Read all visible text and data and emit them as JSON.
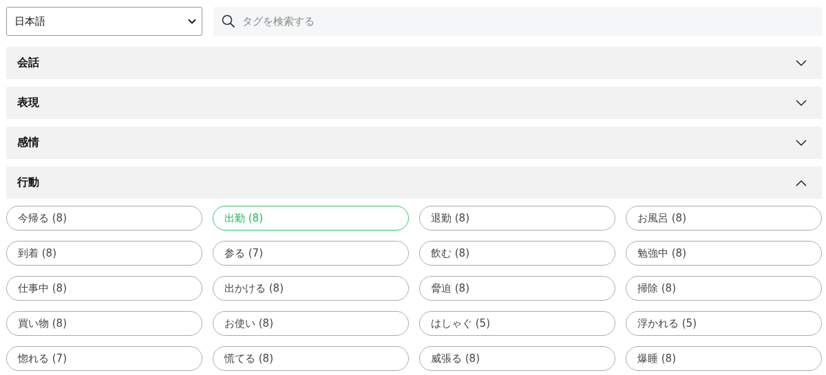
{
  "language_select": {
    "value": "日本語"
  },
  "search": {
    "placeholder": "タグを検索する"
  },
  "sections": [
    {
      "title": "会話",
      "expanded": false
    },
    {
      "title": "表現",
      "expanded": false
    },
    {
      "title": "感情",
      "expanded": false
    },
    {
      "title": "行動",
      "expanded": true,
      "tags": [
        {
          "label": "今帰る (8)",
          "selected": false
        },
        {
          "label": "出勤 (8)",
          "selected": true
        },
        {
          "label": "退勤 (8)",
          "selected": false
        },
        {
          "label": "お風呂 (8)",
          "selected": false
        },
        {
          "label": "到着 (8)",
          "selected": false
        },
        {
          "label": "参る (7)",
          "selected": false
        },
        {
          "label": "飲む (8)",
          "selected": false
        },
        {
          "label": "勉強中 (8)",
          "selected": false
        },
        {
          "label": "仕事中 (8)",
          "selected": false
        },
        {
          "label": "出かける (8)",
          "selected": false
        },
        {
          "label": "脅迫 (8)",
          "selected": false
        },
        {
          "label": "掃除 (8)",
          "selected": false
        },
        {
          "label": "買い物 (8)",
          "selected": false
        },
        {
          "label": "お使い (8)",
          "selected": false
        },
        {
          "label": "はしゃぐ (5)",
          "selected": false
        },
        {
          "label": "浮かれる (5)",
          "selected": false
        },
        {
          "label": "惚れる (7)",
          "selected": false
        },
        {
          "label": "慌てる (8)",
          "selected": false
        },
        {
          "label": "威張る (8)",
          "selected": false
        },
        {
          "label": "爆睡 (8)",
          "selected": false
        }
      ]
    }
  ]
}
